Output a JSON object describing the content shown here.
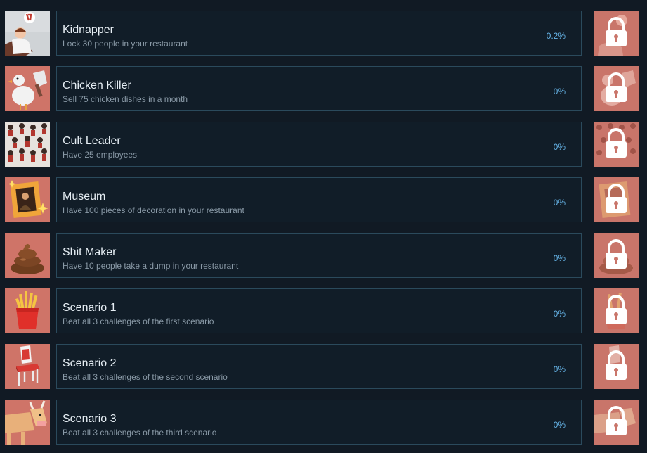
{
  "achievements": [
    {
      "title": "Kidnapper",
      "description": "Lock 30 people in your restaurant",
      "percent": "0.2%",
      "icon": "kidnapper-icon"
    },
    {
      "title": "Chicken Killer",
      "description": "Sell 75 chicken dishes in a month",
      "percent": "0%",
      "icon": "chicken-killer-icon"
    },
    {
      "title": "Cult Leader",
      "description": "Have 25 employees",
      "percent": "0%",
      "icon": "cult-leader-icon"
    },
    {
      "title": "Museum",
      "description": "Have 100 pieces of decoration in your restaurant",
      "percent": "0%",
      "icon": "museum-icon"
    },
    {
      "title": "Shit Maker",
      "description": "Have 10 people take a dump in your restaurant",
      "percent": "0%",
      "icon": "poop-icon"
    },
    {
      "title": "Scenario 1",
      "description": "Beat all 3 challenges of the first scenario",
      "percent": "0%",
      "icon": "fries-icon"
    },
    {
      "title": "Scenario 2",
      "description": "Beat all 3 challenges of the second scenario",
      "percent": "0%",
      "icon": "chair-icon"
    },
    {
      "title": "Scenario 3",
      "description": "Beat all 3 challenges of the third scenario",
      "percent": "0%",
      "icon": "cow-icon"
    }
  ],
  "colors": {
    "background": "#111a24",
    "card_border": "#2b4a5c",
    "title": "#e6eef4",
    "description": "#8a9aa7",
    "percent": "#67b6ea",
    "icon_bg": "#c9756a"
  }
}
